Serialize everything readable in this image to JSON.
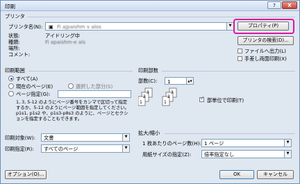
{
  "window": {
    "title": "印刷",
    "help": "?",
    "close": "X"
  },
  "printer": {
    "group": "プリンタ",
    "name_label": "プリンタ名(N):",
    "name_value": "Fi ajpaishm v alos",
    "status_label": "状態:",
    "status_value": "アイドリング中",
    "type_label": "種類:",
    "type_value": "Fi apaishm-e als",
    "place_label": "場所:",
    "comment_label": "コメント:",
    "properties_btn": "プロパティ(P)",
    "find_btn": "プリンタの検索(D)...",
    "to_file": "ファイルへ出力(L)",
    "manual_duplex": "手差し両面印刷(X)"
  },
  "range": {
    "group": "印刷範囲",
    "all": "すべて(A)",
    "current": "現在のページ(E)",
    "selection": "選択した部分(S)",
    "pages": "ページ指定(G):",
    "hint": "1, 3, 5-12 のようにページ番号をカンマで区切って指定するか、5-12 のようにページ範囲を指定してください。p1s1, p1s2 や、p1s3-p8s3 のように、ページとセクションを指定することもできます。"
  },
  "copies": {
    "group": "印刷部数",
    "count_label": "部数(C):",
    "count_value": "1",
    "collate": "部単位で印刷(T)"
  },
  "target": {
    "label": "印刷対象(W):",
    "value": "文書"
  },
  "spec": {
    "label": "印刷指定(R):",
    "value": "すべてのページ"
  },
  "zoom": {
    "group": "拡大/縮小",
    "pages_label": "1 枚あたりのページ数(H):",
    "pages_value": "1 ページ",
    "paper_label": "用紙サイズの指定(Z):",
    "paper_value": "倍率指定なし"
  },
  "footer": {
    "options": "オプション(O)...",
    "ok": "OK",
    "cancel": "キャンセル"
  },
  "colors": {
    "highlight": "#e0159d",
    "accent": "#2a60b0"
  }
}
